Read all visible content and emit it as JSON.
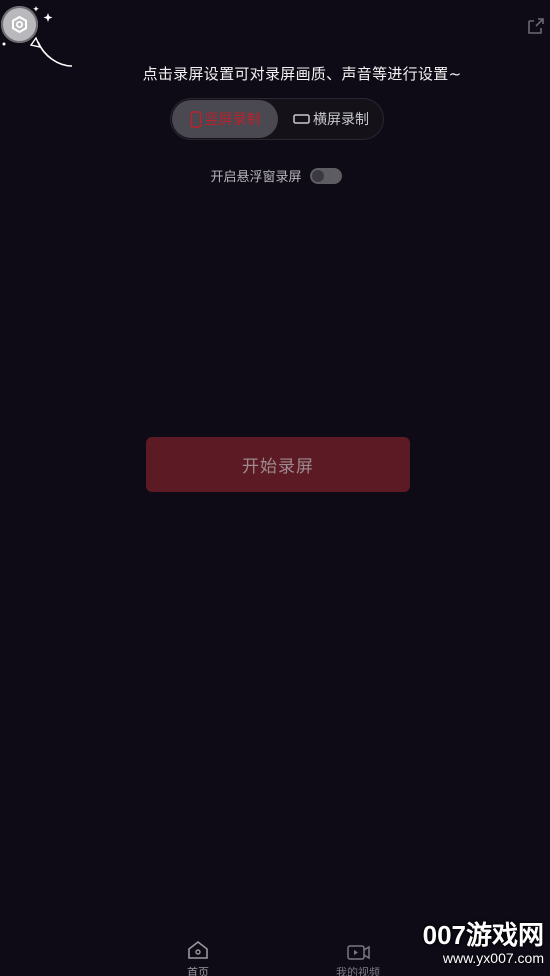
{
  "top_bar": {
    "settings_icon": "settings-hexagon-icon",
    "share_icon": "external-link-icon"
  },
  "hint": {
    "text": "点击录屏设置可对录屏画质、声音等进行设置~"
  },
  "mode_switch": {
    "portrait_label": "竖屏录制",
    "landscape_label": "横屏录制",
    "selected": "portrait",
    "selected_color": "#b8232d"
  },
  "floating_window": {
    "label": "开启悬浮窗录屏",
    "enabled": false
  },
  "start_button": {
    "label": "开始录屏",
    "color": "#5c1a24"
  },
  "bottom_nav": {
    "items": [
      {
        "label": "首页",
        "icon": "home-icon",
        "active": true
      },
      {
        "label": "我的视频",
        "icon": "video-folder-icon",
        "active": false
      }
    ]
  },
  "watermark": {
    "brand": "007游戏网",
    "url": "www.yx007.com"
  }
}
